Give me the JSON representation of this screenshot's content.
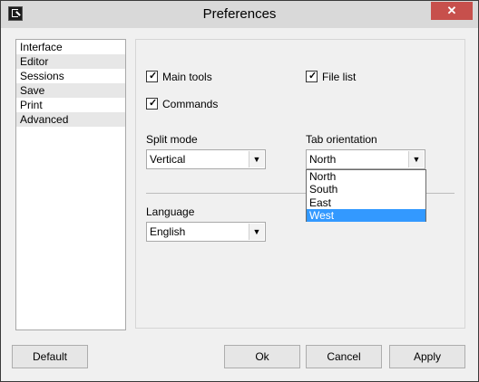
{
  "window": {
    "title": "Preferences",
    "close_glyph": "✕"
  },
  "sidebar": {
    "items": [
      {
        "label": "Interface",
        "active": false
      },
      {
        "label": "Editor",
        "active": false
      },
      {
        "label": "Sessions",
        "active": true
      },
      {
        "label": "Save",
        "active": false
      },
      {
        "label": "Print",
        "active": false
      },
      {
        "label": "Advanced",
        "active": false
      }
    ]
  },
  "panel": {
    "main_tools": {
      "label": "Main tools",
      "checked": true
    },
    "file_list": {
      "label": "File list",
      "checked": true
    },
    "commands": {
      "label": "Commands",
      "checked": true
    },
    "split_mode": {
      "label": "Split mode",
      "value": "Vertical"
    },
    "tab_orientation": {
      "label": "Tab orientation",
      "value": "North",
      "options": [
        "North",
        "South",
        "East",
        "West"
      ],
      "highlighted": "West"
    },
    "language": {
      "label": "Language",
      "value": "English"
    }
  },
  "buttons": {
    "default": "Default",
    "ok": "Ok",
    "cancel": "Cancel",
    "apply": "Apply"
  },
  "icons": {
    "check": "checkmark-icon",
    "dropdown": "chevron-down-icon"
  }
}
